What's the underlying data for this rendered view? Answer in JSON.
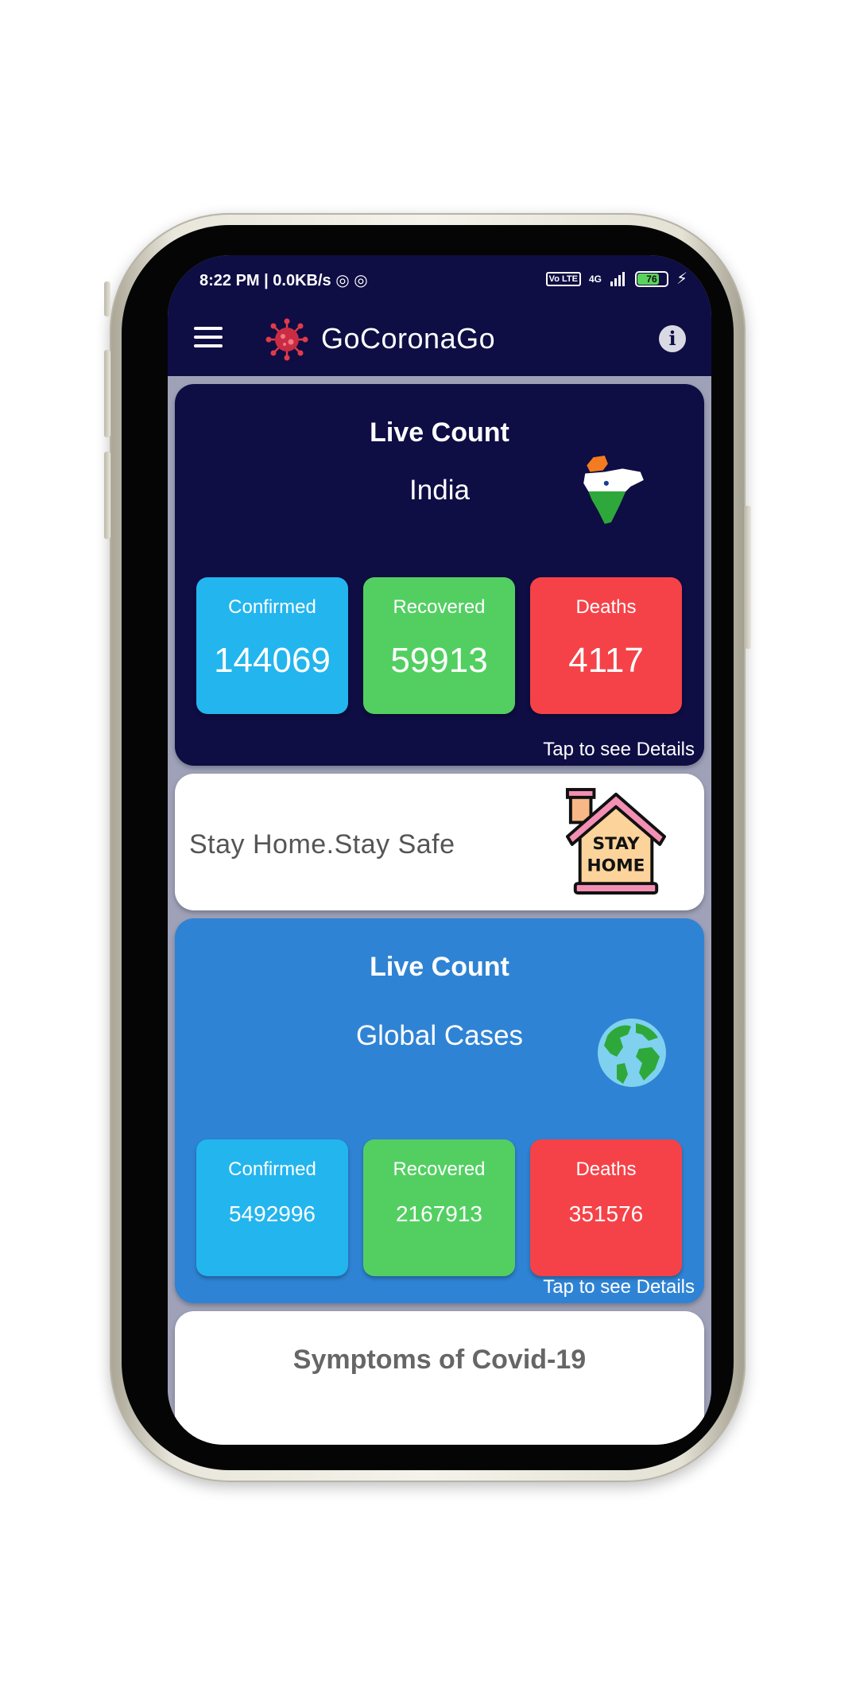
{
  "status_bar": {
    "time_network": "8:22 PM | 0.0KB/s",
    "volte": "Vo LTE",
    "network": "4G",
    "battery": "76"
  },
  "app_bar": {
    "title": "GoCoronaGo",
    "info_symbol": "i"
  },
  "india_card": {
    "title": "Live Count",
    "region": "India",
    "stats": {
      "confirmed_label": "Confirmed",
      "confirmed_value": "144069",
      "recovered_label": "Recovered",
      "recovered_value": "59913",
      "deaths_label": "Deaths",
      "deaths_value": "4117"
    },
    "details_link": "Tap to see Details"
  },
  "stay_home_card": {
    "text": "Stay Home.Stay Safe",
    "icon_text_line1": "STAY",
    "icon_text_line2": "HOME"
  },
  "global_card": {
    "title": "Live Count",
    "region": "Global Cases",
    "stats": {
      "confirmed_label": "Confirmed",
      "confirmed_value": "5492996",
      "recovered_label": "Recovered",
      "recovered_value": "2167913",
      "deaths_label": "Deaths",
      "deaths_value": "351576"
    },
    "details_link": "Tap to see Details"
  },
  "symptoms_card": {
    "title": "Symptoms of Covid-19"
  },
  "icons": [
    "menu-icon",
    "virus-logo-icon",
    "info-icon",
    "india-map-icon",
    "stay-home-house-icon",
    "globe-icon"
  ],
  "colors": {
    "primary_dark": "#0e0d44",
    "global_blue": "#2f83d4",
    "confirmed": "#23b5ee",
    "recovered": "#53cf62",
    "deaths": "#f54248"
  }
}
